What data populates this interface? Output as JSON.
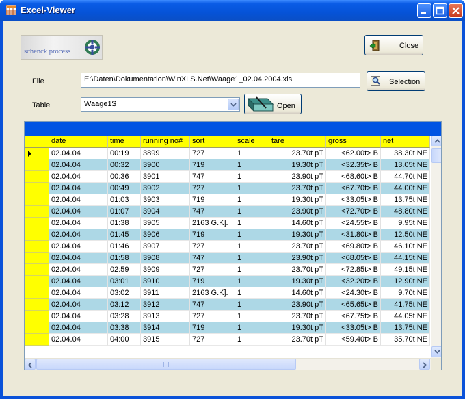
{
  "window": {
    "title": "Excel-Viewer"
  },
  "logo": {
    "text": "schenck process"
  },
  "buttons": {
    "close": "Close",
    "selection": "Selection",
    "open": "Open"
  },
  "file": {
    "label": "File",
    "path": "E:\\Daten\\Dokumentation\\WinXLS.Net\\Waage1_02.04.2004.xls"
  },
  "table": {
    "label": "Table",
    "selected": "Waage1$"
  },
  "grid": {
    "columns": [
      "date",
      "time",
      "running no#",
      "sort",
      "scale",
      "tare",
      "gross",
      "net"
    ],
    "rows": [
      [
        "02.04.04",
        "00:19",
        "3899",
        "727",
        "1",
        "23.70t  pT",
        "<62.00t>  B",
        "38.30t NE"
      ],
      [
        "02.04.04",
        "00:32",
        "3900",
        "719",
        "1",
        "19.30t  pT",
        "<32.35t>  B",
        "13.05t NE"
      ],
      [
        "02.04.04",
        "00:36",
        "3901",
        "747",
        "1",
        "23.90t  pT",
        "<68.60t>  B",
        "44.70t NE"
      ],
      [
        "02.04.04",
        "00:49",
        "3902",
        "727",
        "1",
        "23.70t  pT",
        "<67.70t>  B",
        "44.00t NE"
      ],
      [
        "02.04.04",
        "01:03",
        "3903",
        "719",
        "1",
        "19.30t  pT",
        "<33.05t>  B",
        "13.75t NE"
      ],
      [
        "02.04.04",
        "01:07",
        "3904",
        "747",
        "1",
        "23.90t  pT",
        "<72.70t>  B",
        "48.80t NE"
      ],
      [
        "02.04.04",
        "01:38",
        "3905",
        "2163 G.K].",
        "1",
        "14.60t  pT",
        "<24.55t>  B",
        "9.95t NE"
      ],
      [
        "02.04.04",
        "01:45",
        "3906",
        "719",
        "1",
        "19.30t  pT",
        "<31.80t>  B",
        "12.50t NE"
      ],
      [
        "02.04.04",
        "01:46",
        "3907",
        "727",
        "1",
        "23.70t  pT",
        "<69.80t>  B",
        "46.10t NE"
      ],
      [
        "02.04.04",
        "01:58",
        "3908",
        "747",
        "1",
        "23.90t  pT",
        "<68.05t>  B",
        "44.15t NE"
      ],
      [
        "02.04.04",
        "02:59",
        "3909",
        "727",
        "1",
        "23.70t  pT",
        "<72.85t>  B",
        "49.15t NE"
      ],
      [
        "02.04.04",
        "03:01",
        "3910",
        "719",
        "1",
        "19.30t  pT",
        "<32.20t>  B",
        "12.90t NE"
      ],
      [
        "02.04.04",
        "03:02",
        "3911",
        "2163 G.K].",
        "1",
        "14.60t  pT",
        "<24.30t>  B",
        "9.70t NE"
      ],
      [
        "02.04.04",
        "03:12",
        "3912",
        "747",
        "1",
        "23.90t  pT",
        "<65.65t>  B",
        "41.75t NE"
      ],
      [
        "02.04.04",
        "03:28",
        "3913",
        "727",
        "1",
        "23.70t  pT",
        "<67.75t>  B",
        "44.05t NE"
      ],
      [
        "02.04.04",
        "03:38",
        "3914",
        "719",
        "1",
        "19.30t  pT",
        "<33.05t>  B",
        "13.75t NE"
      ],
      [
        "02.04.04",
        "04:00",
        "3915",
        "727",
        "1",
        "23.70t  pT",
        "<59.40t>  B",
        "35.70t NE"
      ]
    ],
    "current_row": 0
  },
  "colors": {
    "header": "#ffff00",
    "alt_row": "#add8e6",
    "caption": "#0054e3",
    "titlebar": "#0553d8"
  },
  "icons": {
    "app": "excel-viewer-app-icon",
    "close": "exit-door-icon",
    "selection": "search-magnifier-icon",
    "open": "open-table-icon"
  }
}
